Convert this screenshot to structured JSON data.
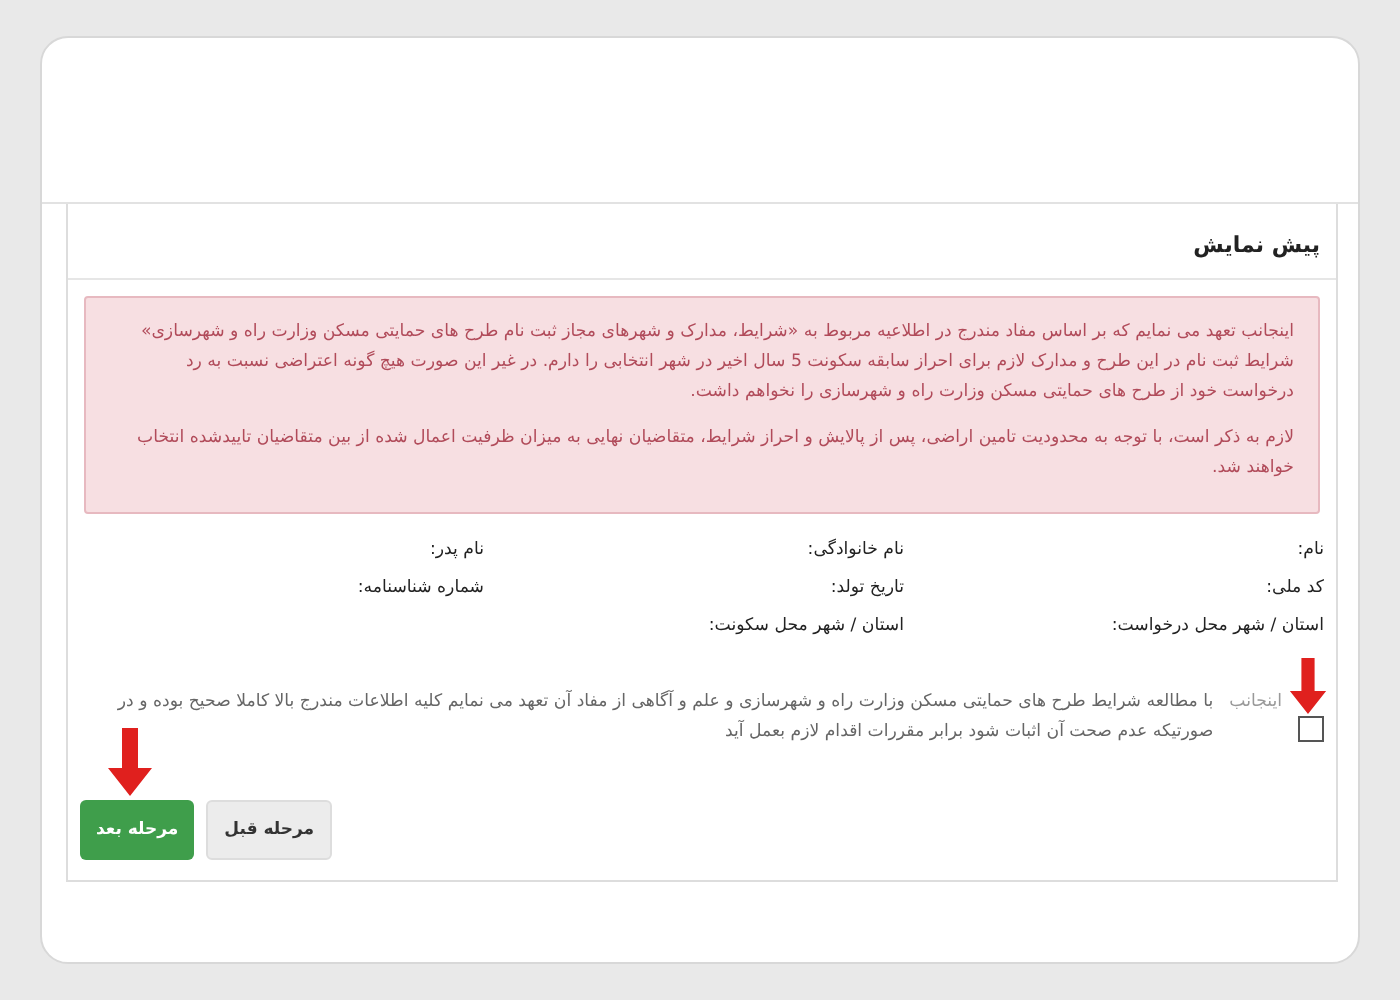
{
  "panel": {
    "title": "پیش نمایش"
  },
  "alert": {
    "paragraphs": [
      "اینجانب تعهد می نمایم که بر اساس مفاد مندرج در اطلاعیه مربوط به «شرایط، مدارک و شهرهای مجاز ثبت نام طرح های حمایتی مسکن وزارت راه و شهرسازی» شرایط ثبت نام در این طرح و مدارک لازم برای احراز سابقه سکونت 5 سال اخیر در شهر انتخابی را دارم. در غیر این صورت هیچ گونه اعتراضی نسبت به رد درخواست خود از طرح های حمایتی مسکن وزارت راه و شهرسازی را نخواهم داشت.",
      "لازم به ذکر است، با توجه به محدودیت تامین اراضی، پس از پالایش و احراز شرایط، متقاضیان نهایی به میزان ظرفیت اعمال شده از بین متقاضیان تاییدشده انتخاب خواهند شد."
    ]
  },
  "fields": [
    {
      "label": "نام:"
    },
    {
      "label": "نام خانوادگی:"
    },
    {
      "label": "نام پدر:"
    },
    {
      "label": "کد ملی:"
    },
    {
      "label": "تاریخ تولد:"
    },
    {
      "label": "شماره شناسنامه:"
    },
    {
      "label": "استان / شهر محل درخواست:"
    },
    {
      "label": "استان / شهر محل سکونت:"
    }
  ],
  "agreement": {
    "checked": false,
    "label": "اینجانب",
    "text": "با مطالعه شرایط طرح های حمایتی مسکن وزارت راه و شهرسازی و علم و آگاهی از مفاد آن تعهد می نمایم کلیه اطلاعات مندرج بالا کاملا صحیح بوده و در صورتیکه عدم صحت آن اثبات شود برابر مقررات اقدام لازم بعمل آید"
  },
  "buttons": [
    {
      "label": "مرحله قبل",
      "kind": "default"
    },
    {
      "label": "مرحله بعد",
      "kind": "primary"
    }
  ]
}
